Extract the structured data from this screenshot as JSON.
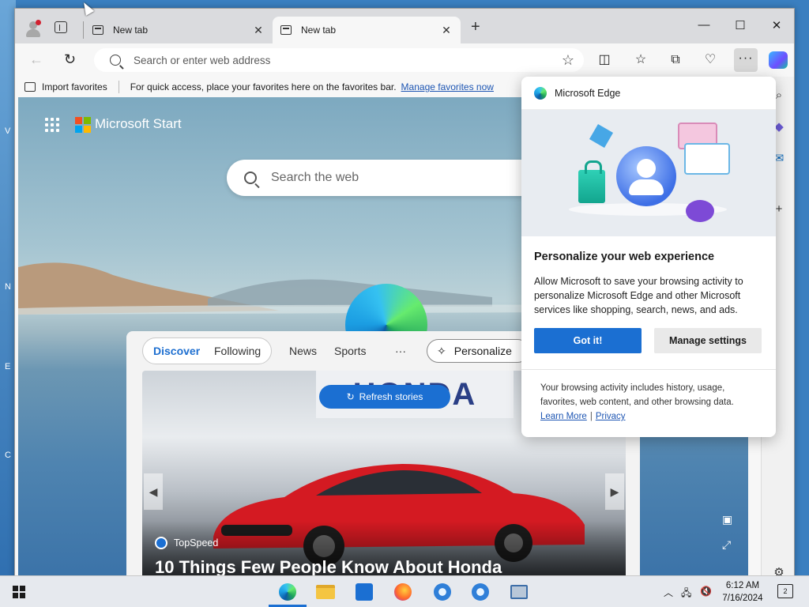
{
  "desktop": {
    "edge_letters": [
      "V",
      "N",
      "E",
      "C"
    ]
  },
  "tabs": [
    {
      "title": "New tab",
      "active": false
    },
    {
      "title": "New tab",
      "active": true
    }
  ],
  "window_controls": {
    "minimize": "—",
    "maximize": "☐",
    "close": "✕"
  },
  "address": {
    "placeholder": "Search or enter web address"
  },
  "favorites_bar": {
    "import_label": "Import favorites",
    "hint": "For quick access, place your favorites here on the favorites bar.",
    "manage_link": "Manage favorites now"
  },
  "newtab": {
    "brand": "Microsoft Start",
    "search_placeholder": "Search the web",
    "feed_tabs": [
      "Discover",
      "Following",
      "News",
      "Sports",
      "···"
    ],
    "personalize": "Personalize",
    "refresh": "Refresh stories",
    "story": {
      "sign": "HONDA",
      "source": "TopSpeed",
      "headline": "10 Things Few People Know About Honda"
    }
  },
  "popup": {
    "brand": "Microsoft Edge",
    "title": "Personalize your web experience",
    "body": "Allow Microsoft to save your browsing activity to personalize Microsoft Edge and other Microsoft services like shopping, search, news, and ads.",
    "primary_button": "Got it!",
    "secondary_button": "Manage settings",
    "footer": "Your browsing activity includes history, usage, favorites, web content, and other browsing data.",
    "learn_more": "Learn More",
    "separator": "|",
    "privacy": "Privacy"
  },
  "taskbar": {
    "time": "6:12 AM",
    "date": "7/16/2024",
    "notifications": "2"
  },
  "colors": {
    "accent": "#1b6fd2",
    "link": "#1e56b3"
  }
}
